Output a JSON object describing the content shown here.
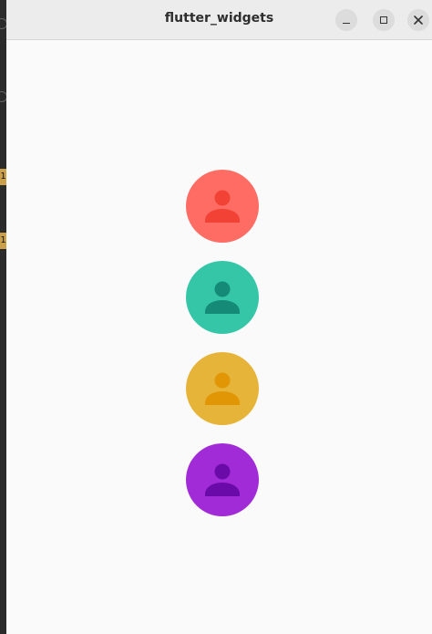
{
  "window": {
    "title": "flutter_widgets"
  },
  "left_strip": {
    "badges": [
      "1",
      "1"
    ]
  },
  "avatars": [
    {
      "background": "#ff6c63",
      "icon_color": "#f24236"
    },
    {
      "background": "#34c6a7",
      "icon_color": "#158a77"
    },
    {
      "background": "#e7b43a",
      "icon_color": "#e19605"
    },
    {
      "background": "#a12bd6",
      "icon_color": "#6a0aa8"
    }
  ],
  "icons": {
    "avatar": "person-icon",
    "minimize": "minimize-icon",
    "maximize": "maximize-icon",
    "close": "close-icon"
  }
}
